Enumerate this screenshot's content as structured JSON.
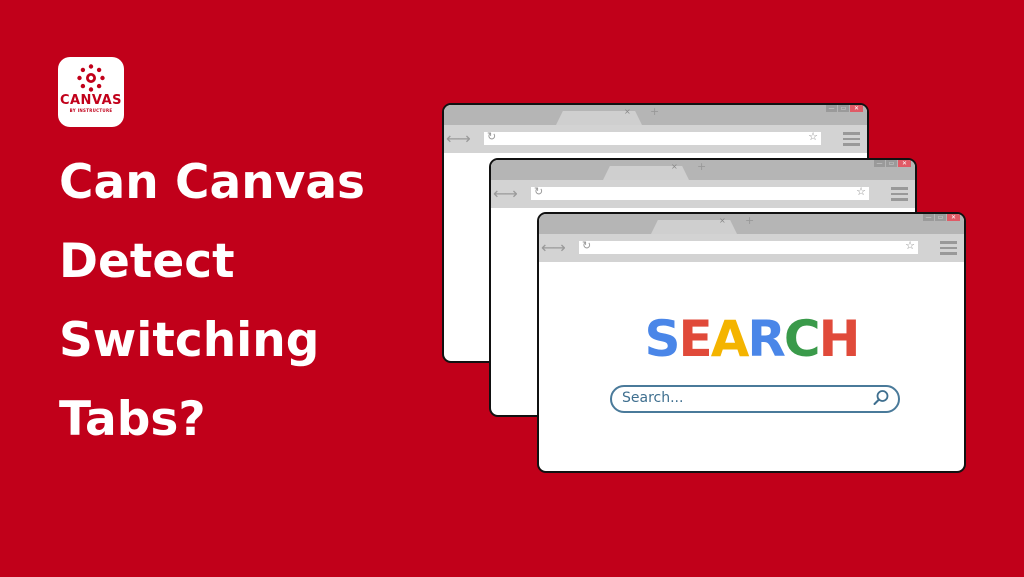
{
  "logo": {
    "name": "CANVAS",
    "tagline": "BY INSTRUCTURE",
    "color": "#c1001a"
  },
  "headline": {
    "lines": [
      "Can Canvas",
      "Detect",
      "Switching",
      "Tabs?"
    ]
  },
  "background_color": "#c1001a",
  "browser_windows": [
    {
      "id": "back",
      "tab_close": "×",
      "tab_new": "+",
      "controls": [
        "minimize",
        "restore",
        "close"
      ]
    },
    {
      "id": "middle",
      "tab_close": "×",
      "tab_new": "+",
      "controls": [
        "minimize",
        "restore",
        "close"
      ]
    },
    {
      "id": "front",
      "tab_close": "×",
      "tab_new": "+",
      "controls": [
        "minimize",
        "restore",
        "close"
      ]
    }
  ],
  "icons": {
    "back": "←",
    "forward": "→",
    "reload": "↻",
    "bookmark": "☆",
    "menu": "hamburger-icon"
  },
  "search_page": {
    "letters": [
      {
        "char": "S",
        "color": "#4a86e8"
      },
      {
        "char": "E",
        "color": "#e04a3a"
      },
      {
        "char": "A",
        "color": "#f4b400"
      },
      {
        "char": "R",
        "color": "#4a86e8"
      },
      {
        "char": "C",
        "color": "#3a9a4a"
      },
      {
        "char": "H",
        "color": "#e04a3a"
      }
    ],
    "search_placeholder": "Search..."
  }
}
